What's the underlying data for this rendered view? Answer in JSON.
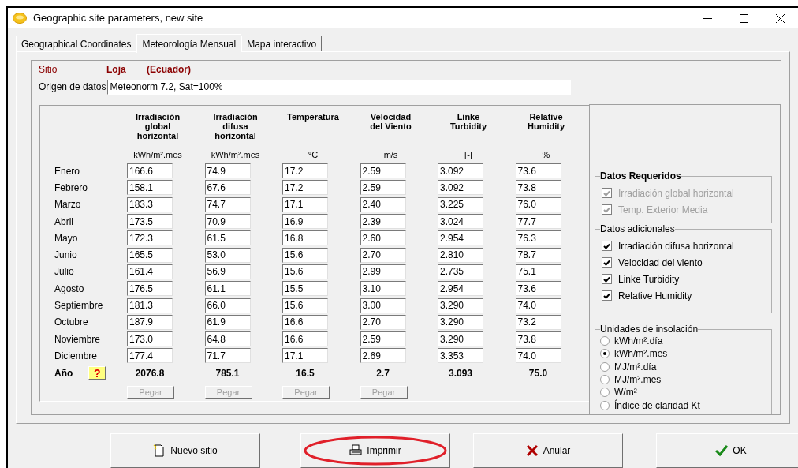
{
  "window": {
    "title": "Geographic site parameters, new site"
  },
  "tabs": [
    {
      "label": "Geographical Coordinates",
      "selected": false
    },
    {
      "label": "Meteorología Mensual",
      "selected": true
    },
    {
      "label": "Mapa interactivo",
      "selected": false
    }
  ],
  "site": {
    "label": "Sitio",
    "name": "Loja",
    "country": "(Ecuador)"
  },
  "source": {
    "label": "Origen de datos",
    "value": "Meteonorm 7.2, Sat=100%"
  },
  "table": {
    "columns": [
      {
        "title": [
          "Irradiación",
          "global",
          "horizontal"
        ],
        "unit": "kWh/m².mes"
      },
      {
        "title": [
          "Irradiación",
          "difusa",
          "horizontal"
        ],
        "unit": "kWh/m².mes"
      },
      {
        "title": [
          "Temperatura"
        ],
        "unit": "°C"
      },
      {
        "title": [
          "Velocidad",
          "del Viento"
        ],
        "unit": "m/s"
      },
      {
        "title": [
          "Linke",
          "Turbidity"
        ],
        "unit": "[-]"
      },
      {
        "title": [
          "Relative",
          "Humidity"
        ],
        "unit": "%"
      }
    ],
    "rows": [
      {
        "month": "Enero",
        "values": [
          "166.6",
          "74.9",
          "17.2",
          "2.59",
          "3.092",
          "73.6"
        ]
      },
      {
        "month": "Febrero",
        "values": [
          "158.1",
          "67.6",
          "17.2",
          "2.59",
          "3.092",
          "73.8"
        ]
      },
      {
        "month": "Marzo",
        "values": [
          "183.3",
          "74.7",
          "17.1",
          "2.40",
          "3.225",
          "76.0"
        ]
      },
      {
        "month": "Abril",
        "values": [
          "173.5",
          "70.9",
          "16.9",
          "2.39",
          "3.024",
          "77.7"
        ]
      },
      {
        "month": "Mayo",
        "values": [
          "172.3",
          "61.5",
          "16.8",
          "2.60",
          "2.954",
          "76.3"
        ]
      },
      {
        "month": "Junio",
        "values": [
          "165.5",
          "53.0",
          "15.6",
          "2.70",
          "2.810",
          "78.7"
        ]
      },
      {
        "month": "Julio",
        "values": [
          "161.4",
          "56.9",
          "15.6",
          "2.99",
          "2.735",
          "75.1"
        ]
      },
      {
        "month": "Agosto",
        "values": [
          "176.5",
          "61.1",
          "15.5",
          "3.10",
          "2.954",
          "73.6"
        ]
      },
      {
        "month": "Septiembre",
        "values": [
          "181.3",
          "66.0",
          "15.6",
          "3.00",
          "3.290",
          "74.0"
        ]
      },
      {
        "month": "Octubre",
        "values": [
          "187.9",
          "61.9",
          "16.6",
          "2.70",
          "3.290",
          "73.2"
        ]
      },
      {
        "month": "Noviembre",
        "values": [
          "173.0",
          "64.8",
          "16.6",
          "2.59",
          "3.290",
          "73.8"
        ]
      },
      {
        "month": "Diciembre",
        "values": [
          "177.4",
          "71.7",
          "17.1",
          "2.69",
          "3.353",
          "74.0"
        ]
      }
    ],
    "year": {
      "label": "Año",
      "help": "?",
      "values": [
        "2076.8",
        "785.1",
        "16.5",
        "2.7",
        "3.093",
        "75.0"
      ]
    },
    "paste_buttons": [
      {
        "label": "Pegar",
        "disabled": true
      },
      {
        "label": "Pegar",
        "disabled": true
      },
      {
        "label": "Pegar",
        "disabled": true
      },
      {
        "label": "Pegar",
        "disabled": true
      }
    ]
  },
  "required": {
    "title": "Datos Requeridos",
    "items": [
      {
        "label": "Irradiación global horizontal",
        "checked": true,
        "disabled": true
      },
      {
        "label": "Temp. Exterior Media",
        "checked": true,
        "disabled": true
      }
    ]
  },
  "additional": {
    "title": "Datos adicionales",
    "items": [
      {
        "label": "Irradiación difusa horizontal",
        "checked": true,
        "disabled": false
      },
      {
        "label": "Velocidad del viento",
        "checked": true,
        "disabled": false
      },
      {
        "label": "Linke Turbidity",
        "checked": true,
        "disabled": false
      },
      {
        "label": "Relative Humidity",
        "checked": true,
        "disabled": false
      }
    ]
  },
  "units": {
    "title": "Unidades de insolación",
    "options": [
      {
        "label": "kWh/m².día",
        "selected": false
      },
      {
        "label": "kWh/m².mes",
        "selected": true
      },
      {
        "label": "MJ/m².día",
        "selected": false
      },
      {
        "label": "MJ/m².mes",
        "selected": false
      },
      {
        "label": "W/m²",
        "selected": false
      },
      {
        "label": "Índice de claridad Kt",
        "selected": false
      }
    ]
  },
  "buttons": [
    {
      "label": "Nuevo sitio",
      "kind": "new",
      "highlighted": false
    },
    {
      "label": "Imprimir",
      "kind": "print",
      "highlighted": true
    },
    {
      "label": "Anular",
      "kind": "cancel",
      "highlighted": false
    },
    {
      "label": "OK",
      "kind": "ok",
      "highlighted": false
    }
  ]
}
